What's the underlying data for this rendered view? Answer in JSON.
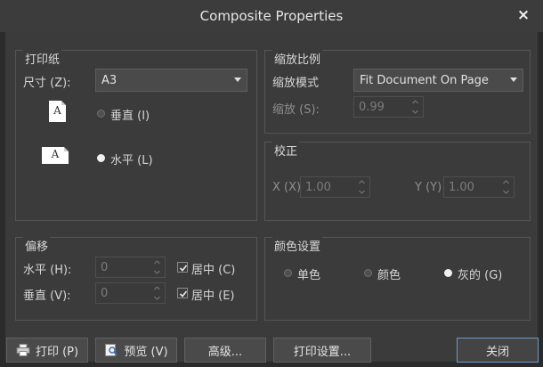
{
  "window": {
    "title": "Composite Properties",
    "close_glyph": "×"
  },
  "paper": {
    "title": "打印纸",
    "size_label": "尺寸 (Z):",
    "size_value": "A3",
    "portrait_label": "垂直 (I)",
    "landscape_label": "水平 (L)",
    "portrait_icon_letter": "A",
    "landscape_icon_letter": "A",
    "orientation": "landscape"
  },
  "scaling": {
    "title": "缩放比例",
    "mode_label": "缩放模式",
    "mode_value": "Fit Document On Page",
    "scale_label": "缩放 (S):",
    "scale_value": "0.99"
  },
  "correction": {
    "title": "校正",
    "x_label": "X (X)",
    "x_value": "1.00",
    "y_label": "Y (Y)",
    "y_value": "1.00"
  },
  "offset": {
    "title": "偏移",
    "horizontal_label": "水平 (H):",
    "horizontal_value": "0",
    "horizontal_center_label": "居中 (C)",
    "vertical_label": "垂直 (V):",
    "vertical_value": "0",
    "vertical_center_label": "居中 (E)",
    "horizontal_centered": true,
    "vertical_centered": true
  },
  "color": {
    "title": "颜色设置",
    "mono_label": "单色",
    "color_label": "颜色",
    "gray_label": "灰的 (G)",
    "selected": "gray"
  },
  "buttons": {
    "print": "打印 (P)",
    "preview": "预览 (V)",
    "advanced": "高级...",
    "print_setup": "打印设置...",
    "close": "关闭"
  }
}
